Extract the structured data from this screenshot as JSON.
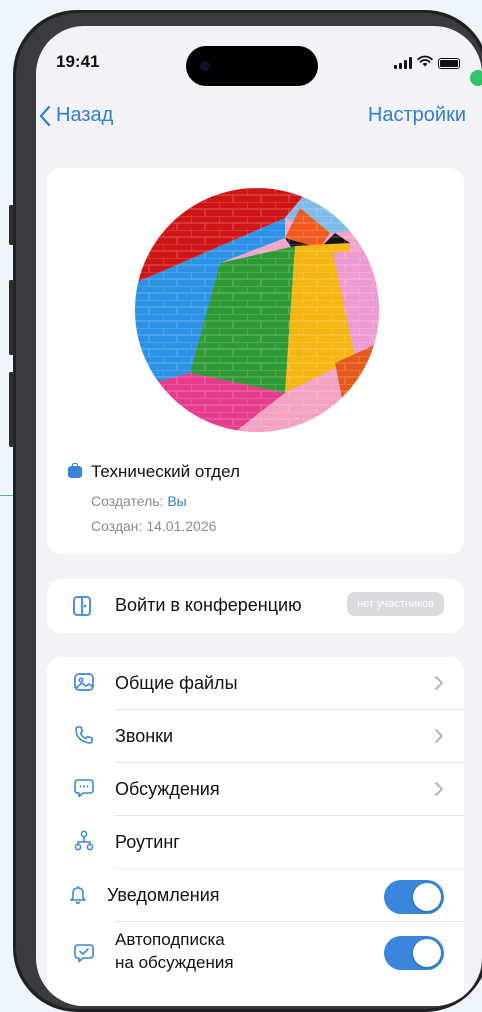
{
  "status_bar": {
    "time": "19:41"
  },
  "nav": {
    "back_label": "Назад",
    "settings_label": "Настройки"
  },
  "profile": {
    "name": "Технический отдел",
    "creator_label": "Создатель:",
    "creator_value": "Вы",
    "created_label": "Создан:",
    "created_value": "14.01.2026"
  },
  "conference": {
    "label": "Войти в конференцию",
    "badge": "нет участников"
  },
  "menu": {
    "items": [
      {
        "label": "Общие файлы",
        "icon": "image-icon",
        "control": "chevron"
      },
      {
        "label": "Звонки",
        "icon": "phone-icon",
        "control": "chevron"
      },
      {
        "label": "Обсуждения",
        "icon": "chat-icon",
        "control": "chevron"
      },
      {
        "label": "Роутинг",
        "icon": "routing-icon",
        "control": "none"
      },
      {
        "label": "Уведомления",
        "icon": "bell-icon",
        "control": "toggle",
        "on": true
      },
      {
        "label_line1": "Автоподписка",
        "label_line2": "на обсуждения",
        "icon": "chat-check-icon",
        "control": "toggle",
        "on": true
      }
    ]
  },
  "colors": {
    "accent": "#2f7fd4",
    "toggle_on": "#3a86dc",
    "background": "#f2f2f7"
  }
}
